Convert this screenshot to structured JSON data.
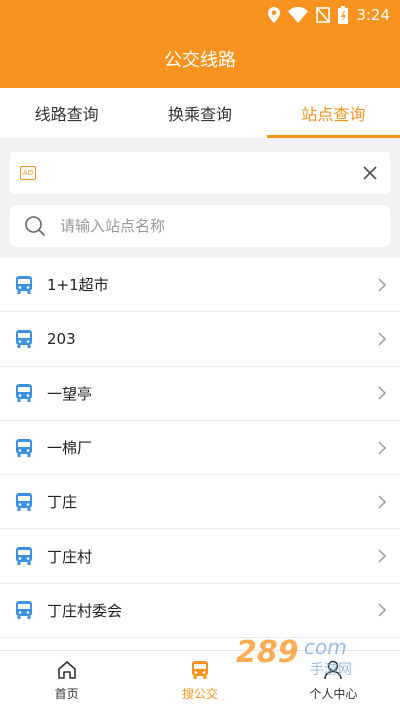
{
  "status": {
    "time": "3:24"
  },
  "title": "公交线路",
  "tabs": [
    {
      "label": "线路查询",
      "active": false
    },
    {
      "label": "换乘查询",
      "active": false
    },
    {
      "label": "站点查询",
      "active": true
    }
  ],
  "ad": {
    "tag": "AD"
  },
  "search": {
    "placeholder": "请输入站点名称"
  },
  "stations": [
    "1+1超市",
    "203",
    "一望亭",
    "一棉厂",
    "丁庄",
    "丁庄村",
    "丁庄村委会"
  ],
  "nav": [
    {
      "label": "首页",
      "icon": "home-icon",
      "active": false
    },
    {
      "label": "搜公交",
      "icon": "bus-icon",
      "active": true
    },
    {
      "label": "个人中心",
      "icon": "user-icon",
      "active": false
    }
  ],
  "colors": {
    "accent": "#f7931e",
    "bus_icon": "#3d8fe0"
  }
}
